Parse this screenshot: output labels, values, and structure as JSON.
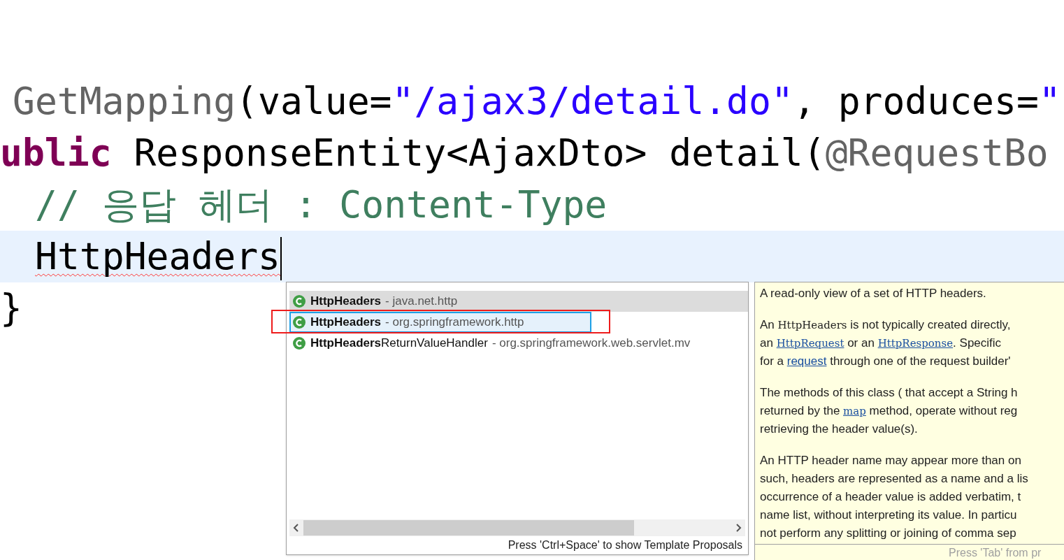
{
  "editor": {
    "lines": [
      {
        "indent": false,
        "current": false,
        "segments": [
          {
            "kind": "annotation",
            "text": "GetMapping"
          },
          {
            "kind": "plain",
            "text": "(value="
          },
          {
            "kind": "string",
            "text": "\"/ajax3/detail.do\""
          },
          {
            "kind": "plain",
            "text": ", produces="
          },
          {
            "kind": "string",
            "text": "\""
          }
        ]
      },
      {
        "indent": false,
        "current": false,
        "segments": [
          {
            "kind": "keyword",
            "text": "ublic"
          },
          {
            "kind": "plain",
            "text": " ResponseEntity<AjaxDto> detail("
          },
          {
            "kind": "annotation",
            "text": "@RequestBo"
          }
        ]
      },
      {
        "indent": true,
        "current": false,
        "segments": [
          {
            "kind": "comment",
            "text": "// 응답 헤더 : Content-Type"
          }
        ]
      },
      {
        "indent": true,
        "current": true,
        "error": true,
        "segments": [
          {
            "kind": "plain",
            "text": "HttpHeaders"
          }
        ]
      },
      {
        "indent": false,
        "current": false,
        "segments": [
          {
            "kind": "plain",
            "text": "}"
          }
        ]
      }
    ]
  },
  "proposals": {
    "items": [
      {
        "name": "HttpHeaders",
        "package": "- java.net.http",
        "selected": true,
        "marked": false
      },
      {
        "name": "HttpHeaders",
        "package": "- org.springframework.http",
        "selected": false,
        "marked": true
      },
      {
        "name": "HttpHeaders",
        "rest": "ReturnValueHandler",
        "package": "- org.springframework.web.servlet.mv",
        "selected": false,
        "marked": false
      }
    ],
    "status": "Press 'Ctrl+Space' to show Template Proposals"
  },
  "doc": {
    "paragraphs": [
      [
        [
          {
            "kind": "text",
            "text": "A read-only view of a set of HTTP headers."
          }
        ]
      ],
      [
        [
          {
            "kind": "text",
            "text": "An "
          },
          {
            "kind": "code",
            "text": "HttpHeaders"
          },
          {
            "kind": "text",
            "text": " is not typically created directly,"
          }
        ],
        [
          {
            "kind": "text",
            "text": "an "
          },
          {
            "kind": "link",
            "text": "HttpRequest"
          },
          {
            "kind": "text",
            "text": " or an "
          },
          {
            "kind": "link",
            "text": "HttpResponse"
          },
          {
            "kind": "text",
            "text": ". Specific"
          }
        ],
        [
          {
            "kind": "text",
            "text": "for a "
          },
          {
            "kind": "link-text",
            "text": "request"
          },
          {
            "kind": "text",
            "text": " through one of the request builder'"
          }
        ]
      ],
      [
        [
          {
            "kind": "text",
            "text": "The methods of this class ( that accept a String h"
          }
        ],
        [
          {
            "kind": "text",
            "text": "returned by the "
          },
          {
            "kind": "link",
            "text": "map"
          },
          {
            "kind": "text",
            "text": " method, operate without reg"
          }
        ],
        [
          {
            "kind": "text",
            "text": "retrieving the header value(s)."
          }
        ]
      ],
      [
        [
          {
            "kind": "text",
            "text": "An HTTP header name may appear more than on"
          }
        ],
        [
          {
            "kind": "text",
            "text": "such, headers are represented as a name and a lis"
          }
        ],
        [
          {
            "kind": "text",
            "text": "occurrence of a header value is added verbatim, t"
          }
        ],
        [
          {
            "kind": "text",
            "text": "name list, without interpreting its value. In particu"
          }
        ],
        [
          {
            "kind": "text",
            "text": "not perform any splitting or joining of comma sep"
          }
        ]
      ]
    ],
    "footer": "Press 'Tab' from pr"
  }
}
